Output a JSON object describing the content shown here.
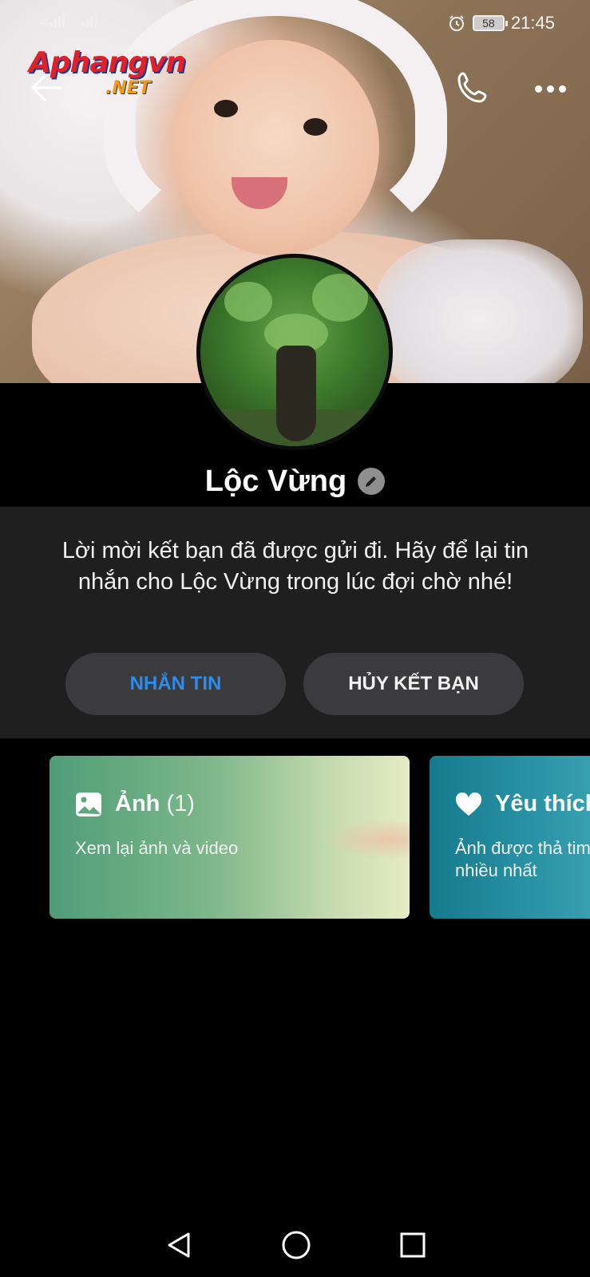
{
  "status_bar": {
    "network_type": "4G",
    "time": "21:45",
    "battery": "58",
    "icons": [
      "signal-icon",
      "alarm-icon",
      "battery-icon"
    ]
  },
  "watermark": {
    "line1": "Aphangvn",
    "line2": ".NET"
  },
  "header": {
    "back_icon": "arrow-left-icon",
    "call_icon": "phone-icon",
    "more_icon": "more-horizontal-icon"
  },
  "profile": {
    "name": "Lộc Vừng",
    "edit_icon": "pencil-icon"
  },
  "friend_request": {
    "message": "Lời mời kết bạn đã được gửi đi. Hãy để lại tin nhắn cho Lộc Vừng trong lúc đợi chờ nhé!",
    "message_button": "NHẮN TIN",
    "unfriend_button": "HỦY KẾT BẠN"
  },
  "cards": [
    {
      "icon": "image-icon",
      "title": "Ảnh",
      "count": "(1)",
      "subtitle": "Xem lại ảnh và video"
    },
    {
      "icon": "heart-icon",
      "title": "Yêu thích",
      "subtitle": "Ảnh được thả tim nhiều nhất"
    }
  ],
  "nav_bar": {
    "icons": [
      "back-triangle-icon",
      "home-circle-icon",
      "recents-square-icon"
    ]
  },
  "colors": {
    "accent_blue": "#2a8df0",
    "panel_bg": "#1f1f1f",
    "button_bg": "#3b3b3d"
  }
}
